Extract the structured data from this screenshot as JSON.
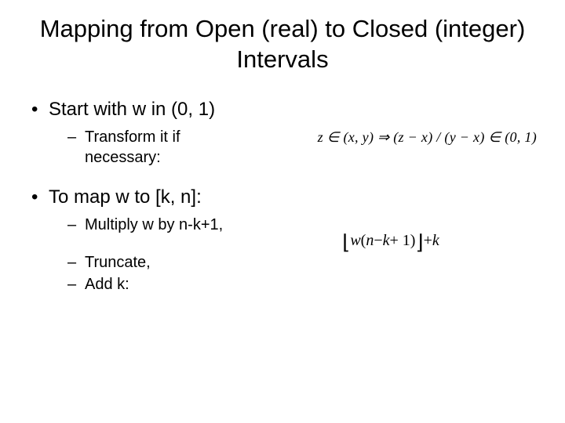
{
  "title": "Mapping from Open (real) to Closed (integer) Intervals",
  "b1": {
    "text": "Start with w in (0, 1)",
    "sub1": "Transform it if necessary:",
    "formula": "z ∈ (x, y) ⇒ (z − x) / (y − x) ∈ (0, 1)"
  },
  "b2": {
    "text": "To map w to [k, n]:",
    "sub1": "Multiply w by n-k+1,",
    "sub2": "Truncate,",
    "sub3": "Add k:",
    "formula": "⌊w(n − k + 1)⌋ + k"
  }
}
